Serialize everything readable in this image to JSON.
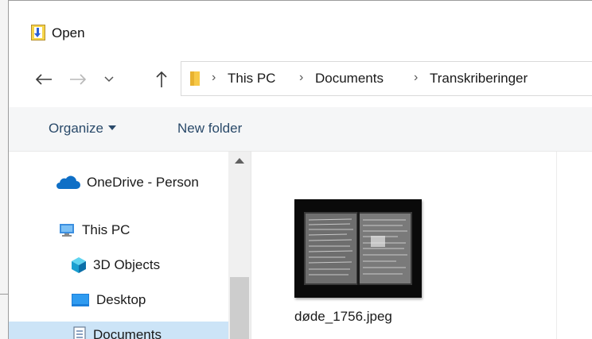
{
  "window": {
    "title": "Open"
  },
  "address": {
    "crumbs": [
      "This PC",
      "Documents",
      "Transkriberinger"
    ]
  },
  "toolbar": {
    "organize_label": "Organize",
    "new_folder_label": "New folder"
  },
  "nav_pane": {
    "items": [
      {
        "label": "OneDrive - Person",
        "icon": "onedrive-cloud-icon"
      },
      {
        "label": "This PC",
        "icon": "computer-icon"
      },
      {
        "label": "3D Objects",
        "icon": "3d-objects-icon"
      },
      {
        "label": "Desktop",
        "icon": "desktop-icon"
      },
      {
        "label": "Documents",
        "icon": "documents-icon",
        "selected": true
      }
    ]
  },
  "files": [
    {
      "name": "døde_1756.jpeg",
      "icon": "image-thumbnail"
    }
  ],
  "colors": {
    "accent": "#0078d4",
    "selection": "#cce4f7",
    "command_text": "#2a4a6a"
  }
}
